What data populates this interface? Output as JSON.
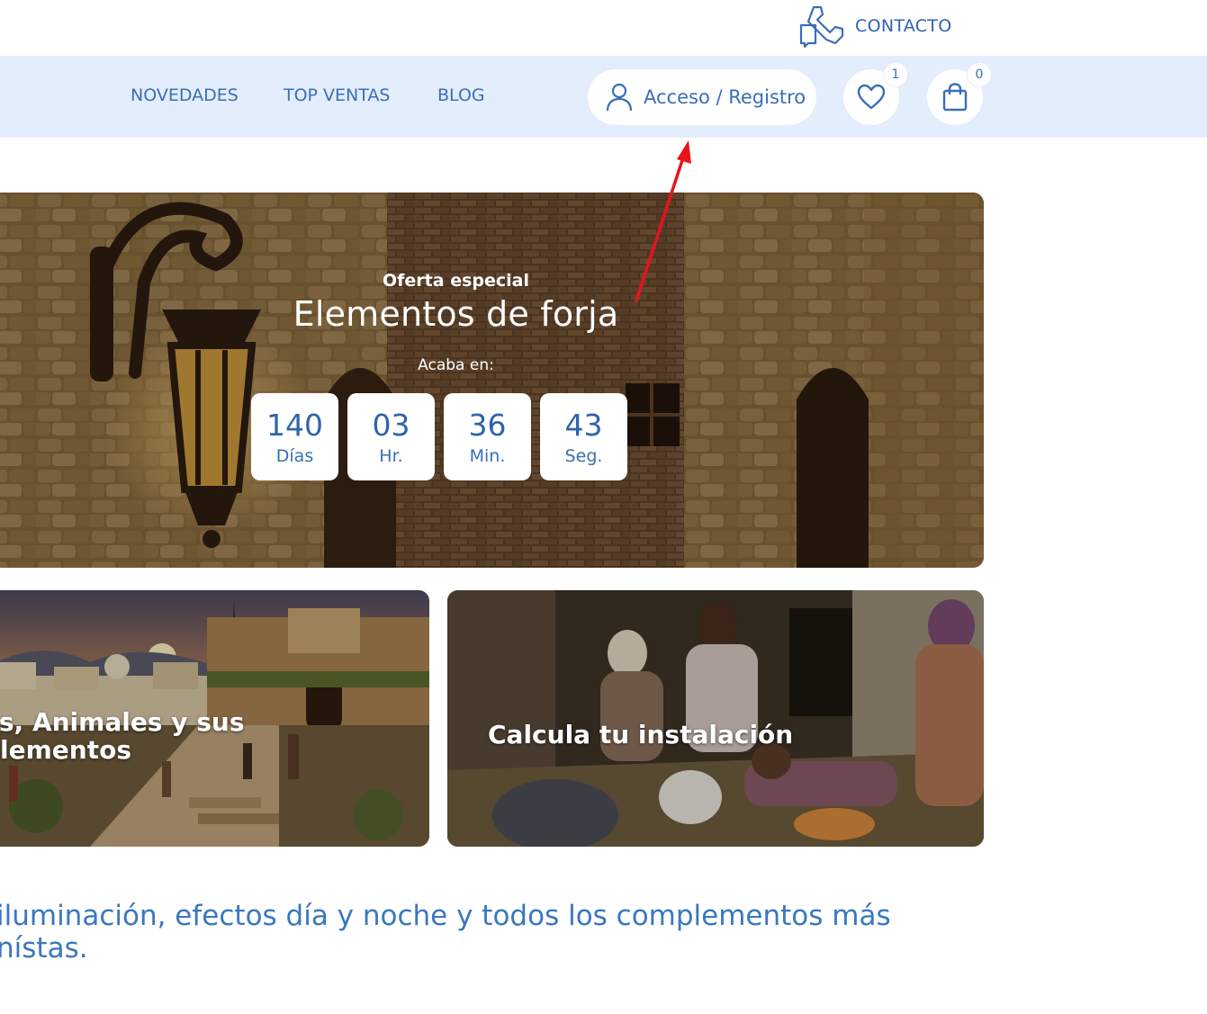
{
  "header": {
    "contact_label": "CONTACTO",
    "contact_icon": "phone-icon"
  },
  "nav": {
    "items": [
      {
        "label": "NOVEDADES"
      },
      {
        "label": "TOP VENTAS"
      },
      {
        "label": "BLOG"
      }
    ],
    "login_label": "Acceso / Registro",
    "login_icon": "user-icon",
    "wishlist_count": "1",
    "wishlist_icon": "heart-icon",
    "cart_count": "0",
    "cart_icon": "shopping-bag-icon"
  },
  "hero": {
    "kicker": "Oferta especial",
    "title": "Elementos de forja",
    "ends_label": "Acaba en:",
    "countdown": [
      {
        "value": "140",
        "unit": "Días"
      },
      {
        "value": "03",
        "unit": "Hr."
      },
      {
        "value": "36",
        "unit": "Min."
      },
      {
        "value": "43",
        "unit": "Seg."
      }
    ]
  },
  "cards": [
    {
      "title_line1": "as, Animales y sus",
      "title_line2": "plementos"
    },
    {
      "title": "Calcula tu instalación"
    }
  ],
  "description": {
    "line1": "iluminación, efectos día y noche y todos los complementos más",
    "line2": "nístas."
  },
  "colors": {
    "brand_blue": "#3a6fb5",
    "nav_bg": "#e3edfb",
    "annotation_red": "#e8141b"
  }
}
